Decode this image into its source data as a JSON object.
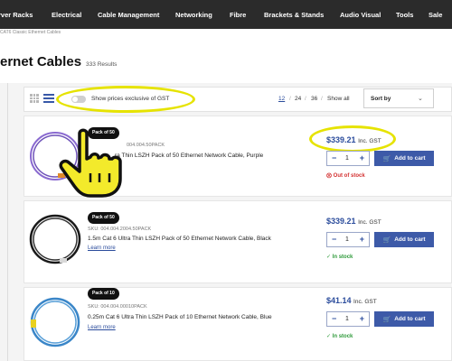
{
  "nav": {
    "items": [
      "rver Racks",
      "Electrical",
      "Cable Management",
      "Networking",
      "Fibre",
      "Brackets & Stands",
      "Audio Visual",
      "Tools",
      "Sale"
    ]
  },
  "breadcrumb": "CAT6 Classic Ethernet Cables",
  "page": {
    "title": "ernet Cables",
    "results": "333 Results"
  },
  "toolbar": {
    "gst_toggle_label": "Show prices exclusive of GST",
    "page_sizes": [
      "12",
      "24",
      "36",
      "Show all"
    ],
    "sort_label": "Sort by"
  },
  "products": [
    {
      "badge": "Pack of 50",
      "sku": "004.004.50PACK",
      "name": "ra Thin LSZH Pack of 50 Ethernet Network Cable, Purple",
      "price": "$339.21",
      "gst": "Inc. GST",
      "qty": "1",
      "cart_label": "Add to cart",
      "status": "Out of stock",
      "cable_color": "#7a5cc0"
    },
    {
      "badge": "Pack of 50",
      "sku": "SKU: 004.004.2004.50PACK",
      "name": "1.5m Cat 6 Ultra Thin LSZH Pack of 50 Ethernet Network Cable, Black",
      "learn_more": "Learn more",
      "price": "$339.21",
      "gst": "Inc. GST",
      "qty": "1",
      "cart_label": "Add to cart",
      "status": "In stock",
      "cable_color": "#1a1a1a"
    },
    {
      "badge": "Pack of 10",
      "sku": "SKU: 004.004.00010PACK",
      "name": "0.25m Cat 6 Ultra Thin LSZH Pack of 10 Ethernet Network Cable, Blue",
      "learn_more": "Learn more",
      "price": "$41.14",
      "gst": "Inc. GST",
      "qty": "1",
      "cart_label": "Add to cart",
      "status": "In stock",
      "cable_color": "#3a86c8"
    }
  ],
  "colors": {
    "nav_bg": "#2b2b2b",
    "accent": "#2b4c9c",
    "button": "#3d5aa8",
    "highlight": "#e6e300",
    "out_of_stock": "#d32f2f",
    "in_stock": "#2e9a3a"
  },
  "icons": [
    "grid-view-icon",
    "list-view-icon",
    "toggle-switch",
    "chevron-down-icon",
    "cart-icon",
    "close-circle-icon",
    "check-circle-icon",
    "pointing-hand-cursor-icon"
  ]
}
